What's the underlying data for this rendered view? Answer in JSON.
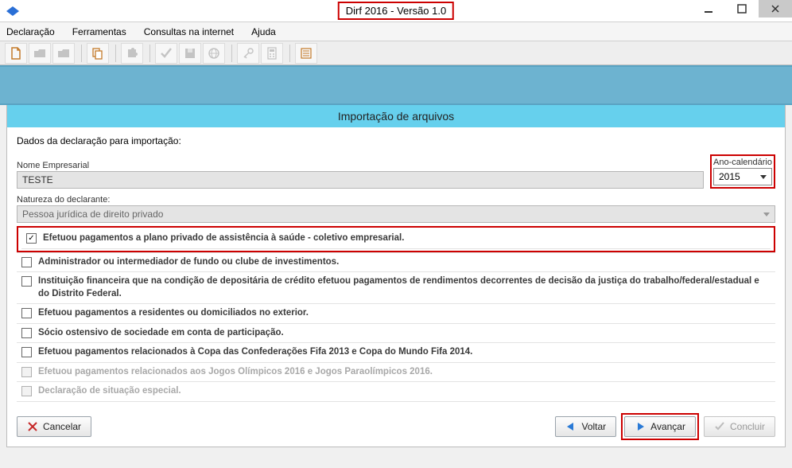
{
  "titlebar": {
    "title": "Dirf 2016 - Versão 1.0"
  },
  "menu": {
    "declaracao": "Declaração",
    "ferramentas": "Ferramentas",
    "consultas": "Consultas na internet",
    "ajuda": "Ajuda"
  },
  "panel": {
    "header": "Importação de arquivos",
    "section_title": "Dados da declaração para importação:",
    "nome_label": "Nome Empresarial",
    "nome_value": "TESTE",
    "ano_label": "Ano-calendário",
    "ano_value": "2015",
    "natureza_label": "Natureza do declarante:",
    "natureza_value": "Pessoa jurídica de direito privado"
  },
  "checks": [
    {
      "label": "Efetuou pagamentos a plano privado de assistência à saúde - coletivo empresarial.",
      "checked": true,
      "disabled": false
    },
    {
      "label": "Administrador ou intermediador de fundo ou clube de investimentos.",
      "checked": false,
      "disabled": false
    },
    {
      "label": "Instituição financeira que na condição de depositária de crédito efetuou pagamentos de rendimentos decorrentes de decisão da justiça do trabalho/federal/estadual e do Distrito Federal.",
      "checked": false,
      "disabled": false
    },
    {
      "label": "Efetuou pagamentos a residentes ou domiciliados no exterior.",
      "checked": false,
      "disabled": false
    },
    {
      "label": "Sócio ostensivo de sociedade em conta de participação.",
      "checked": false,
      "disabled": false
    },
    {
      "label": "Efetuou pagamentos relacionados à Copa das Confederações Fifa 2013 e Copa do Mundo Fifa 2014.",
      "checked": false,
      "disabled": false
    },
    {
      "label": "Efetuou pagamentos relacionados aos Jogos Olímpicos 2016 e Jogos Paraolímpicos 2016.",
      "checked": false,
      "disabled": true
    },
    {
      "label": "Declaração de situação especial.",
      "checked": false,
      "disabled": true
    }
  ],
  "buttons": {
    "cancelar": "Cancelar",
    "voltar": "Voltar",
    "avancar": "Avançar",
    "concluir": "Concluir"
  }
}
